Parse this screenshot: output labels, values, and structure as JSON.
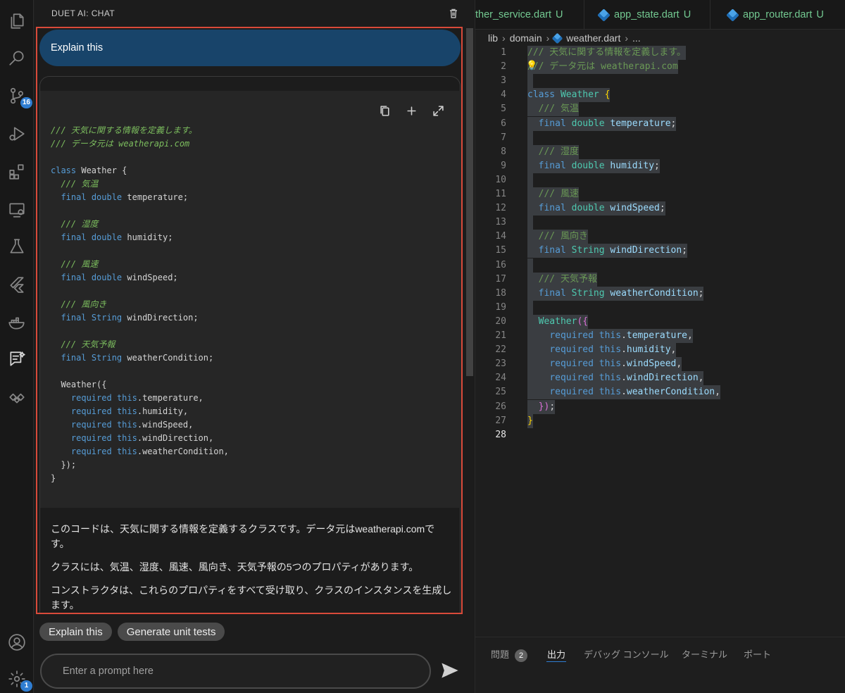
{
  "activity_bar": {
    "source_control_badge": "16",
    "settings_badge": "1"
  },
  "chat": {
    "title": "DUET AI: CHAT",
    "user_message": "Explain this",
    "code_lines": [
      [
        {
          "c": "cm",
          "t": "/// 天気に関する情報を定義します。"
        }
      ],
      [
        {
          "c": "cm",
          "t": "/// データ元は weatherapi.com"
        }
      ],
      [],
      [
        {
          "c": "kw",
          "t": "class"
        },
        {
          "c": "",
          "t": " Weather {"
        }
      ],
      [
        {
          "c": "",
          "t": "  "
        },
        {
          "c": "cm",
          "t": "/// 気温"
        }
      ],
      [
        {
          "c": "",
          "t": "  "
        },
        {
          "c": "kw",
          "t": "final"
        },
        {
          "c": "",
          "t": " "
        },
        {
          "c": "kw",
          "t": "double"
        },
        {
          "c": "",
          "t": " temperature;"
        }
      ],
      [],
      [
        {
          "c": "",
          "t": "  "
        },
        {
          "c": "cm",
          "t": "/// 湿度"
        }
      ],
      [
        {
          "c": "",
          "t": "  "
        },
        {
          "c": "kw",
          "t": "final"
        },
        {
          "c": "",
          "t": " "
        },
        {
          "c": "kw",
          "t": "double"
        },
        {
          "c": "",
          "t": " humidity;"
        }
      ],
      [],
      [
        {
          "c": "",
          "t": "  "
        },
        {
          "c": "cm",
          "t": "/// 風速"
        }
      ],
      [
        {
          "c": "",
          "t": "  "
        },
        {
          "c": "kw",
          "t": "final"
        },
        {
          "c": "",
          "t": " "
        },
        {
          "c": "kw",
          "t": "double"
        },
        {
          "c": "",
          "t": " windSpeed;"
        }
      ],
      [],
      [
        {
          "c": "",
          "t": "  "
        },
        {
          "c": "cm",
          "t": "/// 風向き"
        }
      ],
      [
        {
          "c": "",
          "t": "  "
        },
        {
          "c": "kw",
          "t": "final"
        },
        {
          "c": "",
          "t": " "
        },
        {
          "c": "kw",
          "t": "String"
        },
        {
          "c": "",
          "t": " windDirection;"
        }
      ],
      [],
      [
        {
          "c": "",
          "t": "  "
        },
        {
          "c": "cm",
          "t": "/// 天気予報"
        }
      ],
      [
        {
          "c": "",
          "t": "  "
        },
        {
          "c": "kw",
          "t": "final"
        },
        {
          "c": "",
          "t": " "
        },
        {
          "c": "kw",
          "t": "String"
        },
        {
          "c": "",
          "t": " weatherCondition;"
        }
      ],
      [],
      [
        {
          "c": "",
          "t": "  Weather({"
        }
      ],
      [
        {
          "c": "",
          "t": "    "
        },
        {
          "c": "kw",
          "t": "required"
        },
        {
          "c": "",
          "t": " "
        },
        {
          "c": "kw",
          "t": "this"
        },
        {
          "c": "",
          "t": ".temperature,"
        }
      ],
      [
        {
          "c": "",
          "t": "    "
        },
        {
          "c": "kw",
          "t": "required"
        },
        {
          "c": "",
          "t": " "
        },
        {
          "c": "kw",
          "t": "this"
        },
        {
          "c": "",
          "t": ".humidity,"
        }
      ],
      [
        {
          "c": "",
          "t": "    "
        },
        {
          "c": "kw",
          "t": "required"
        },
        {
          "c": "",
          "t": " "
        },
        {
          "c": "kw",
          "t": "this"
        },
        {
          "c": "",
          "t": ".windSpeed,"
        }
      ],
      [
        {
          "c": "",
          "t": "    "
        },
        {
          "c": "kw",
          "t": "required"
        },
        {
          "c": "",
          "t": " "
        },
        {
          "c": "kw",
          "t": "this"
        },
        {
          "c": "",
          "t": ".windDirection,"
        }
      ],
      [
        {
          "c": "",
          "t": "    "
        },
        {
          "c": "kw",
          "t": "required"
        },
        {
          "c": "",
          "t": " "
        },
        {
          "c": "kw",
          "t": "this"
        },
        {
          "c": "",
          "t": ".weatherCondition,"
        }
      ],
      [
        {
          "c": "",
          "t": "  });"
        }
      ],
      [
        {
          "c": "",
          "t": "}"
        }
      ]
    ],
    "explanation": [
      "このコードは、天気に関する情報を定義するクラスです。データ元はweatherapi.comです。",
      "クラスには、気温、湿度、風速、風向き、天気予報の5つのプロパティがあります。",
      "コンストラクタは、これらのプロパティをすべて受け取り、クラスのインスタンスを生成します。"
    ],
    "chips": [
      "Explain this",
      "Generate unit tests"
    ],
    "prompt_placeholder": "Enter a prompt here"
  },
  "editor": {
    "tabs": [
      {
        "name": "ther_service.dart",
        "status": "U"
      },
      {
        "name": "app_state.dart",
        "status": "U"
      },
      {
        "name": "app_router.dart",
        "status": "U"
      }
    ],
    "breadcrumb": [
      "lib",
      "domain",
      "weather.dart",
      "..."
    ],
    "current_line": "28",
    "lines": [
      {
        "n": "1",
        "sel": true,
        "tokens": [
          {
            "c": "ecm",
            "t": "/// 天気に関する情報を定義します。"
          }
        ]
      },
      {
        "n": "2",
        "sel": true,
        "tokens": [
          {
            "c": "ecm",
            "t": "/// データ元は weatherapi.com"
          }
        ]
      },
      {
        "n": "3",
        "sel": true,
        "tokens": [
          {
            "c": "ewh",
            "t": " "
          }
        ]
      },
      {
        "n": "4",
        "sel": true,
        "tokens": [
          {
            "c": "ekw",
            "t": "class"
          },
          {
            "c": "ewh",
            "t": " "
          },
          {
            "c": "ety",
            "t": "Weather"
          },
          {
            "c": "ewh",
            "t": " "
          },
          {
            "c": "ebr",
            "t": "{"
          }
        ]
      },
      {
        "n": "5",
        "sel": true,
        "tokens": [
          {
            "c": "ewh",
            "t": "  "
          },
          {
            "c": "ecm",
            "t": "/// 気温"
          }
        ]
      },
      {
        "n": "6",
        "sel": true,
        "tokens": [
          {
            "c": "ewh",
            "t": "  "
          },
          {
            "c": "ekw",
            "t": "final"
          },
          {
            "c": "ewh",
            "t": " "
          },
          {
            "c": "ety",
            "t": "double"
          },
          {
            "c": "ewh",
            "t": " "
          },
          {
            "c": "eid",
            "t": "temperature"
          },
          {
            "c": "ewh",
            "t": ";"
          }
        ]
      },
      {
        "n": "7",
        "sel": true,
        "tokens": [
          {
            "c": "ewh",
            "t": " "
          }
        ]
      },
      {
        "n": "8",
        "sel": true,
        "tokens": [
          {
            "c": "ewh",
            "t": "  "
          },
          {
            "c": "ecm",
            "t": "/// 湿度"
          }
        ]
      },
      {
        "n": "9",
        "sel": true,
        "tokens": [
          {
            "c": "ewh",
            "t": "  "
          },
          {
            "c": "ekw",
            "t": "final"
          },
          {
            "c": "ewh",
            "t": " "
          },
          {
            "c": "ety",
            "t": "double"
          },
          {
            "c": "ewh",
            "t": " "
          },
          {
            "c": "eid",
            "t": "humidity"
          },
          {
            "c": "ewh",
            "t": ";"
          }
        ]
      },
      {
        "n": "10",
        "sel": true,
        "tokens": [
          {
            "c": "ewh",
            "t": " "
          }
        ]
      },
      {
        "n": "11",
        "sel": true,
        "tokens": [
          {
            "c": "ewh",
            "t": "  "
          },
          {
            "c": "ecm",
            "t": "/// 風速"
          }
        ]
      },
      {
        "n": "12",
        "sel": true,
        "tokens": [
          {
            "c": "ewh",
            "t": "  "
          },
          {
            "c": "ekw",
            "t": "final"
          },
          {
            "c": "ewh",
            "t": " "
          },
          {
            "c": "ety",
            "t": "double"
          },
          {
            "c": "ewh",
            "t": " "
          },
          {
            "c": "eid",
            "t": "windSpeed"
          },
          {
            "c": "ewh",
            "t": ";"
          }
        ]
      },
      {
        "n": "13",
        "sel": true,
        "tokens": [
          {
            "c": "ewh",
            "t": " "
          }
        ]
      },
      {
        "n": "14",
        "sel": true,
        "tokens": [
          {
            "c": "ewh",
            "t": "  "
          },
          {
            "c": "ecm",
            "t": "/// 風向き"
          }
        ]
      },
      {
        "n": "15",
        "sel": true,
        "tokens": [
          {
            "c": "ewh",
            "t": "  "
          },
          {
            "c": "ekw",
            "t": "final"
          },
          {
            "c": "ewh",
            "t": " "
          },
          {
            "c": "ety",
            "t": "String"
          },
          {
            "c": "ewh",
            "t": " "
          },
          {
            "c": "eid",
            "t": "windDirection"
          },
          {
            "c": "ewh",
            "t": ";"
          }
        ]
      },
      {
        "n": "16",
        "sel": true,
        "tokens": [
          {
            "c": "ewh",
            "t": " "
          }
        ]
      },
      {
        "n": "17",
        "sel": true,
        "tokens": [
          {
            "c": "ewh",
            "t": "  "
          },
          {
            "c": "ecm",
            "t": "/// 天気予報"
          }
        ]
      },
      {
        "n": "18",
        "sel": true,
        "tokens": [
          {
            "c": "ewh",
            "t": "  "
          },
          {
            "c": "ekw",
            "t": "final"
          },
          {
            "c": "ewh",
            "t": " "
          },
          {
            "c": "ety",
            "t": "String"
          },
          {
            "c": "ewh",
            "t": " "
          },
          {
            "c": "eid",
            "t": "weatherCondition"
          },
          {
            "c": "ewh",
            "t": ";"
          }
        ]
      },
      {
        "n": "19",
        "sel": true,
        "tokens": [
          {
            "c": "ewh",
            "t": " "
          }
        ]
      },
      {
        "n": "20",
        "sel": true,
        "tokens": [
          {
            "c": "ewh",
            "t": "  "
          },
          {
            "c": "ety",
            "t": "Weather"
          },
          {
            "c": "ebr2",
            "t": "({"
          }
        ]
      },
      {
        "n": "21",
        "sel": true,
        "tokens": [
          {
            "c": "ewh",
            "t": "    "
          },
          {
            "c": "ekw",
            "t": "required"
          },
          {
            "c": "ewh",
            "t": " "
          },
          {
            "c": "ekw",
            "t": "this"
          },
          {
            "c": "ewh",
            "t": "."
          },
          {
            "c": "eid",
            "t": "temperature"
          },
          {
            "c": "ewh",
            "t": ","
          }
        ]
      },
      {
        "n": "22",
        "sel": true,
        "tokens": [
          {
            "c": "ewh",
            "t": "    "
          },
          {
            "c": "ekw",
            "t": "required"
          },
          {
            "c": "ewh",
            "t": " "
          },
          {
            "c": "ekw",
            "t": "this"
          },
          {
            "c": "ewh",
            "t": "."
          },
          {
            "c": "eid",
            "t": "humidity"
          },
          {
            "c": "ewh",
            "t": ","
          }
        ]
      },
      {
        "n": "23",
        "sel": true,
        "tokens": [
          {
            "c": "ewh",
            "t": "    "
          },
          {
            "c": "ekw",
            "t": "required"
          },
          {
            "c": "ewh",
            "t": " "
          },
          {
            "c": "ekw",
            "t": "this"
          },
          {
            "c": "ewh",
            "t": "."
          },
          {
            "c": "eid",
            "t": "windSpeed"
          },
          {
            "c": "ewh",
            "t": ","
          }
        ]
      },
      {
        "n": "24",
        "sel": true,
        "tokens": [
          {
            "c": "ewh",
            "t": "    "
          },
          {
            "c": "ekw",
            "t": "required"
          },
          {
            "c": "ewh",
            "t": " "
          },
          {
            "c": "ekw",
            "t": "this"
          },
          {
            "c": "ewh",
            "t": "."
          },
          {
            "c": "eid",
            "t": "windDirection"
          },
          {
            "c": "ewh",
            "t": ","
          }
        ]
      },
      {
        "n": "25",
        "sel": true,
        "tokens": [
          {
            "c": "ewh",
            "t": "    "
          },
          {
            "c": "ekw",
            "t": "required"
          },
          {
            "c": "ewh",
            "t": " "
          },
          {
            "c": "ekw",
            "t": "this"
          },
          {
            "c": "ewh",
            "t": "."
          },
          {
            "c": "eid",
            "t": "weatherCondition"
          },
          {
            "c": "ewh",
            "t": ","
          }
        ]
      },
      {
        "n": "26",
        "sel": true,
        "tokens": [
          {
            "c": "ewh",
            "t": "  "
          },
          {
            "c": "ebr2",
            "t": "})"
          },
          {
            "c": "ewh",
            "t": ";"
          }
        ]
      },
      {
        "n": "27",
        "sel": true,
        "tokens": [
          {
            "c": "ebr",
            "t": "}"
          }
        ]
      },
      {
        "n": "28",
        "sel": false,
        "tokens": []
      }
    ]
  },
  "panel": {
    "tabs": [
      {
        "label": "問題",
        "badge": "2"
      },
      {
        "label": "出力",
        "active": true
      },
      {
        "label": "デバッグ コンソール"
      },
      {
        "label": "ターミナル"
      },
      {
        "label": "ポート"
      }
    ]
  },
  "colors": {
    "accent": "#2f7dd1",
    "user_bubble": "#18446a",
    "highlight_border": "#d94a3a",
    "untracked_file": "#73c991"
  }
}
